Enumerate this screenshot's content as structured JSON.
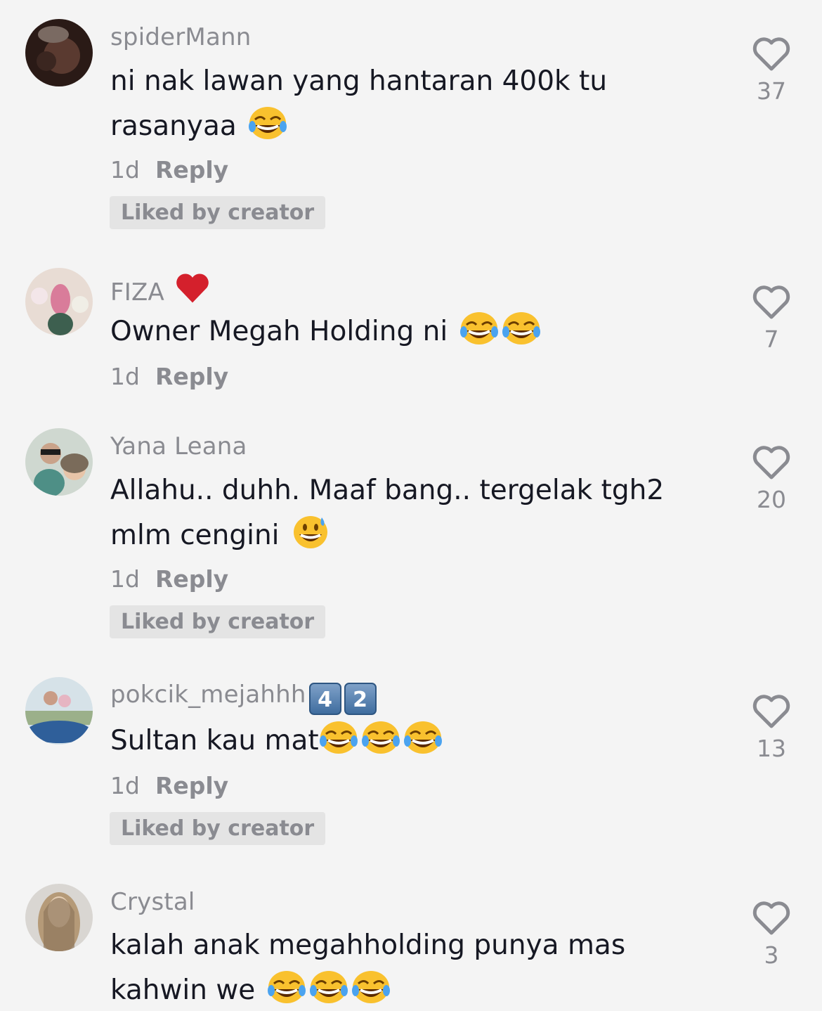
{
  "comments": [
    {
      "username": "spiderMann",
      "text_line1": "ni nak lawan yang hantaran 400k tu",
      "text_line2": "rasanyaa",
      "time": "1d",
      "reply_label": "Reply",
      "liked_label": "Liked by creator",
      "likes": "37",
      "avatar_icon": "avatar-dark-photo"
    },
    {
      "username": "FIZA",
      "username_emoji": "heart-icon",
      "text": "Owner Megah Holding ni",
      "time": "1d",
      "reply_label": "Reply",
      "likes": "7",
      "avatar_icon": "avatar-flowers-photo"
    },
    {
      "username": "Yana Leana",
      "text_line1": "Allahu.. duhh. Maaf bang.. tergelak tgh2",
      "text_line2": "mlm cengini",
      "time": "1d",
      "reply_label": "Reply",
      "liked_label": "Liked by creator",
      "likes": "20",
      "avatar_icon": "avatar-couple-photo"
    },
    {
      "username": "pokcik_mejahhh",
      "keycaps": [
        "4",
        "2"
      ],
      "text": "Sultan kau mat",
      "time": "1d",
      "reply_label": "Reply",
      "liked_label": "Liked by creator",
      "likes": "13",
      "avatar_icon": "avatar-car-photo"
    },
    {
      "username": "Crystal",
      "text_line1": "kalah anak megahholding punya mas",
      "text_line2": "kahwin we",
      "likes": "3",
      "avatar_icon": "avatar-hair-photo"
    }
  ],
  "colors": {
    "background": "#f4f4f4",
    "text": "#161823",
    "muted": "#8a8b91",
    "badge_bg": "#e4e4e4",
    "heart_red": "#d4202c"
  }
}
